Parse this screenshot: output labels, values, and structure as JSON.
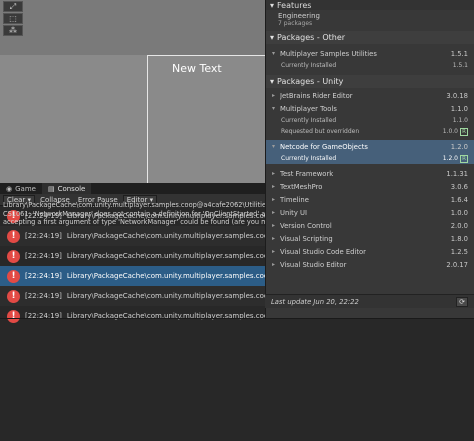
{
  "scene": {
    "canvas_text": "New Text"
  },
  "console": {
    "tabs": [
      {
        "label": "Game"
      },
      {
        "label": "Console"
      }
    ],
    "toolbar": {
      "clear": "Clear",
      "collapse": "Collapse",
      "error_pause": "Error Pause",
      "editor": "Editor"
    },
    "logs": [
      {
        "time": "[22:24:19]",
        "text": "Library\\PackageCache\\com.unity.multiplayer.samples.coop@a4cafe2"
      },
      {
        "time": "[22:24:19]",
        "text": "Library\\PackageCache\\com.unity.multiplayer.samples.coop@a4cafe2"
      },
      {
        "time": "[22:24:19]",
        "text": "Library\\PackageCache\\com.unity.multiplayer.samples.coop@a4cafe2"
      },
      {
        "time": "[22:24:19]",
        "text": "Library\\PackageCache\\com.unity.multiplayer.samples.coop@a4cafe2"
      },
      {
        "time": "[22:24:19]",
        "text": "Library\\PackageCache\\com.unity.multiplayer.samples.coop@a4cafe2"
      },
      {
        "time": "[22:24:19]",
        "text": "Library\\PackageCache\\com.unity.multiplayer.samples.coop@a4cafe2062\\Utilities\\SceneManagement\\SceneLoaderWrapper.cs(83,32): error"
      }
    ],
    "detail": "Library\\PackageCache\\com.unity.multiplayer.samples.coop@a4cafe2062\\Utilities\\SceneManagement\\SceneLoaderWrapper.cs(83,32): error CS1061: 'NetworkManager' does not contain a definition for 'OnClientStarted' and no accessible extension method 'OnClientStarted' accepting a first argument of type 'NetworkManager' could be found (are you missing a using directive or an assembly reference?)"
  },
  "packages": {
    "features_header": "Features",
    "feature_name": "Engineering",
    "feature_count": "7 packages",
    "group_other": "Packages - Other",
    "group_unity": "Packages - Unity",
    "other": [
      {
        "name": "Multiplayer Samples Utilities",
        "ver": "1.5.1",
        "sub": "Currently Installed",
        "subver": "1.5.1"
      }
    ],
    "unity": [
      {
        "name": "JetBrains Rider Editor",
        "ver": "3.0.18"
      },
      {
        "name": "Multiplayer Tools",
        "ver": "1.1.0",
        "subs": [
          {
            "label": "Currently Installed",
            "ver": "1.1.0"
          },
          {
            "label": "Requested but overridden",
            "ver": "1.0.0"
          }
        ]
      },
      {
        "name": "Netcode for GameObjects",
        "ver": "1.2.0",
        "subs": [
          {
            "label": "Currently Installed",
            "ver": "1.2.0"
          }
        ]
      },
      {
        "name": "Test Framework",
        "ver": "1.1.31"
      },
      {
        "name": "TextMeshPro",
        "ver": "3.0.6"
      },
      {
        "name": "Timeline",
        "ver": "1.6.4"
      },
      {
        "name": "Unity UI",
        "ver": "1.0.0"
      },
      {
        "name": "Version Control",
        "ver": "2.0.0"
      },
      {
        "name": "Visual Scripting",
        "ver": "1.8.0"
      },
      {
        "name": "Visual Studio Code Editor",
        "ver": "1.2.5"
      },
      {
        "name": "Visual Studio Editor",
        "ver": "2.0.17"
      }
    ],
    "footer": "Last update Jun 20, 22:22",
    "r_badge": "R"
  },
  "colors": {
    "error": "#e24a45",
    "selection": "#2c5d87",
    "badge": "#9fd8a0"
  }
}
